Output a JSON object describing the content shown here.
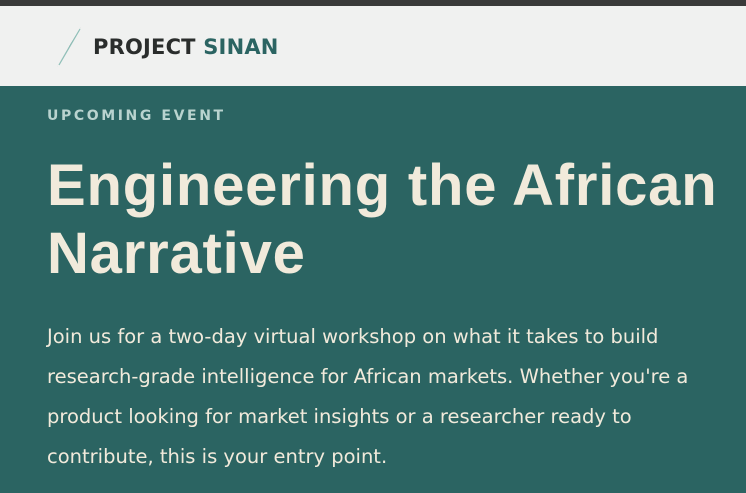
{
  "header": {
    "logo_icon": "compass-needle-icon",
    "brand_project": "PROJECT",
    "brand_sinan": "SINAN"
  },
  "hero": {
    "eyebrow": "UPCOMING EVENT",
    "title": "Engineering the African Narrative",
    "description": "Join us for a two-day virtual workshop on what it takes to build research-grade intelligence for African markets. Whether you're a product looking for market insights or a researcher ready to contribute, this is your entry point."
  },
  "colors": {
    "hero_background": "#2b6462",
    "header_background": "#f0f1f0",
    "title_text": "#f1eadb",
    "eyebrow_text": "#b9d3cf",
    "brand_dark": "#2a2d2c",
    "brand_accent": "#2b6462"
  }
}
